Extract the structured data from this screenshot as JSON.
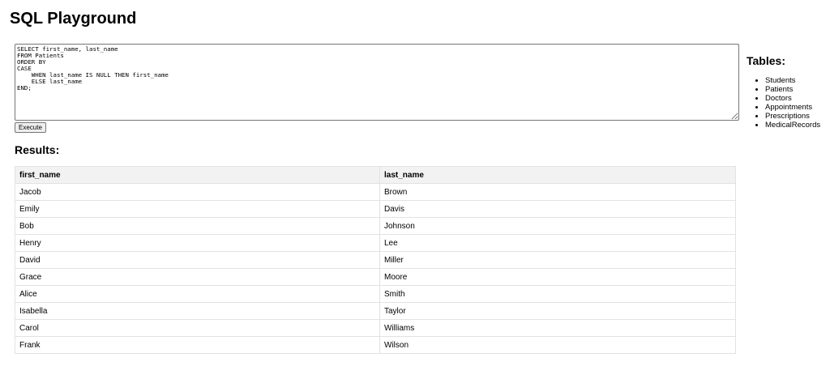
{
  "page": {
    "title": "SQL Playground"
  },
  "editor": {
    "query": "SELECT first_name, last_name\nFROM Patients\nORDER BY\nCASE\n    WHEN last_name IS NULL THEN first_name\n    ELSE last_name\nEND;",
    "execute_label": "Execute"
  },
  "results": {
    "heading": "Results:",
    "columns": [
      "first_name",
      "last_name"
    ],
    "rows": [
      [
        "Jacob",
        "Brown"
      ],
      [
        "Emily",
        "Davis"
      ],
      [
        "Bob",
        "Johnson"
      ],
      [
        "Henry",
        "Lee"
      ],
      [
        "David",
        "Miller"
      ],
      [
        "Grace",
        "Moore"
      ],
      [
        "Alice",
        "Smith"
      ],
      [
        "Isabella",
        "Taylor"
      ],
      [
        "Carol",
        "Williams"
      ],
      [
        "Frank",
        "Wilson"
      ]
    ]
  },
  "sidebar": {
    "heading": "Tables:",
    "tables": [
      "Students",
      "Patients",
      "Doctors",
      "Appointments",
      "Prescriptions",
      "MedicalRecords"
    ]
  }
}
